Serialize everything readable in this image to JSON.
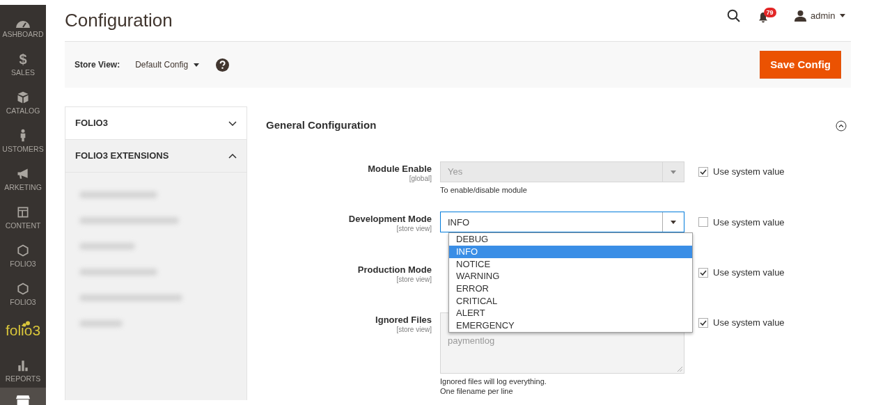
{
  "nav": [
    {
      "kind": "item",
      "label": "ASHBOARD",
      "selected": false
    },
    {
      "kind": "item",
      "glyph": "$",
      "label": "SALES",
      "selected": false
    },
    {
      "kind": "item",
      "label": "CATALOG",
      "selected": false
    },
    {
      "kind": "item",
      "label": "USTOMERS",
      "selected": false
    },
    {
      "kind": "item",
      "label": "ARKETING",
      "selected": false
    },
    {
      "kind": "item",
      "label": "CONTENT",
      "selected": false
    },
    {
      "kind": "item",
      "label": "FOLIO3",
      "selected": false
    },
    {
      "kind": "item",
      "label": "FOLIO3",
      "selected": false
    },
    {
      "kind": "logo",
      "label": "folio3"
    },
    {
      "kind": "item",
      "label": "REPORTS",
      "selected": false
    },
    {
      "kind": "item",
      "selected": true
    }
  ],
  "header": {
    "title": "Configuration",
    "notifications": "79",
    "user": "admin"
  },
  "store_view": {
    "label": "Store View:",
    "value": "Default Config"
  },
  "save_button": "Save Config",
  "config_tabs": [
    {
      "title": "FOLIO3",
      "expanded": false
    },
    {
      "title": "FOLIO3 EXTENSIONS",
      "expanded": true,
      "items": [
        {
          "kind": "blurred"
        },
        {
          "kind": "blurred"
        },
        {
          "kind": "blurred"
        },
        {
          "kind": "blurred"
        },
        {
          "kind": "blurred"
        },
        {
          "kind": "blurred"
        }
      ]
    }
  ],
  "section": {
    "title": "General Configuration",
    "expanded": true
  },
  "fields": [
    {
      "kind": "select",
      "label": "Module Enable",
      "scope": "[global]",
      "value": "Yes",
      "disabled": true,
      "notes": [
        "To enable/disable module"
      ],
      "use_system_value": {
        "label": "Use system value",
        "checked": true
      }
    },
    {
      "kind": "select",
      "label": "Development Mode",
      "scope": "[store view]",
      "value": "INFO",
      "disabled": false,
      "expanded": true,
      "options": [
        {
          "label": "DEBUG",
          "selected": false
        },
        {
          "label": "INFO",
          "selected": true
        },
        {
          "label": "NOTICE",
          "selected": false
        },
        {
          "label": "WARNING",
          "selected": false
        },
        {
          "label": "ERROR",
          "selected": false
        },
        {
          "label": "CRITICAL",
          "selected": false
        },
        {
          "label": "ALERT",
          "selected": false
        },
        {
          "label": "EMERGENCY",
          "selected": false
        }
      ],
      "use_system_value": {
        "label": "Use system value",
        "checked": false
      }
    },
    {
      "kind": "select",
      "label": "Production Mode",
      "scope": "[store view]",
      "use_system_value": {
        "label": "Use system value",
        "checked": true
      }
    },
    {
      "kind": "textarea",
      "label": "Ignored Files",
      "scope": "[store view]",
      "value": "paymentlog",
      "disabled": true,
      "notes": [
        "Ignored files will log everything.",
        "One filename per line"
      ],
      "use_system_value": {
        "label": "Use system value",
        "checked": true
      }
    }
  ]
}
